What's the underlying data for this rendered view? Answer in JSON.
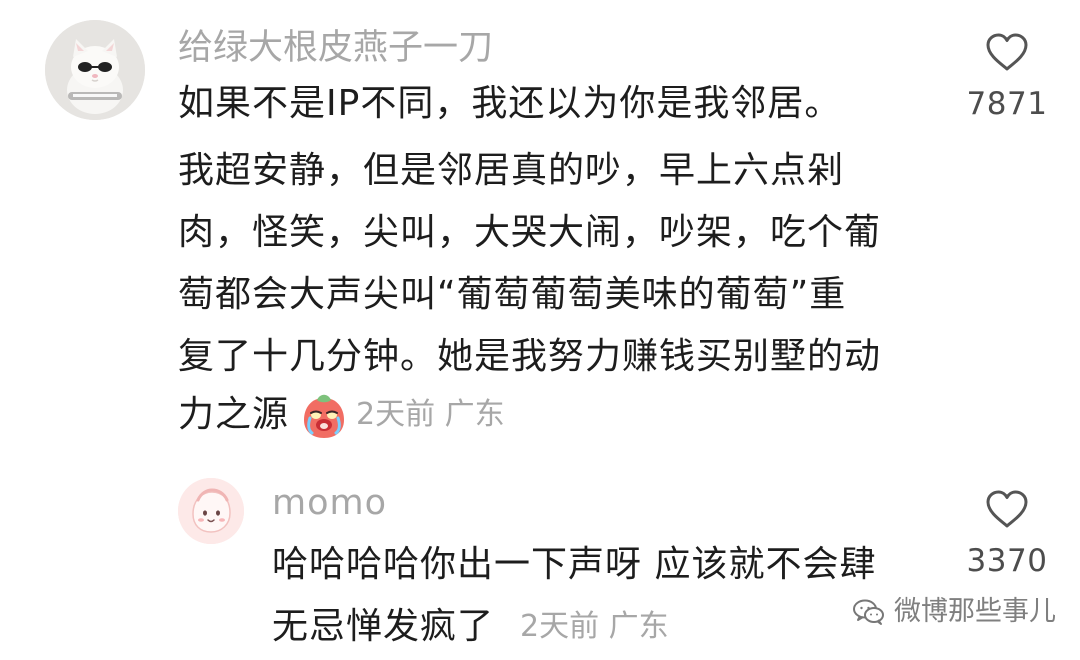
{
  "comment": {
    "username": "给绿大根皮燕子一刀",
    "avatar_icon": "cat-with-sunglasses-avatar",
    "lines": [
      "如果不是IP不同，我还以为你是我邻居。",
      "我超安静，但是邻居真的吵，早上六点剁",
      "肉，怪笑，尖叫，大哭大闹，吵架，吃个葡",
      "萄都会大声尖叫“葡萄葡萄美味的葡萄”重",
      "复了十几分钟。她是我努力赚钱买别墅的动"
    ],
    "last_line": "力之源",
    "emoji_icon": "crying-peach-sticker",
    "meta": "2天前 广东",
    "likes": "7871",
    "heart_icon": "heart-outline-icon"
  },
  "reply": {
    "username": "momo",
    "avatar_icon": "pink-blob-avatar",
    "lines": [
      "哈哈哈哈你出一下声呀 应该就不会肆"
    ],
    "last_line": "无忌惮发疯了",
    "meta": "2天前 广东",
    "likes": "3370",
    "heart_icon": "heart-outline-icon"
  },
  "watermark": {
    "icon": "wechat-icon",
    "text": "微博那些事儿"
  },
  "colors": {
    "text": "#1d1d1d",
    "muted": "#a7a7a7",
    "like_count": "#4d4d4d",
    "background": "#ffffff"
  }
}
